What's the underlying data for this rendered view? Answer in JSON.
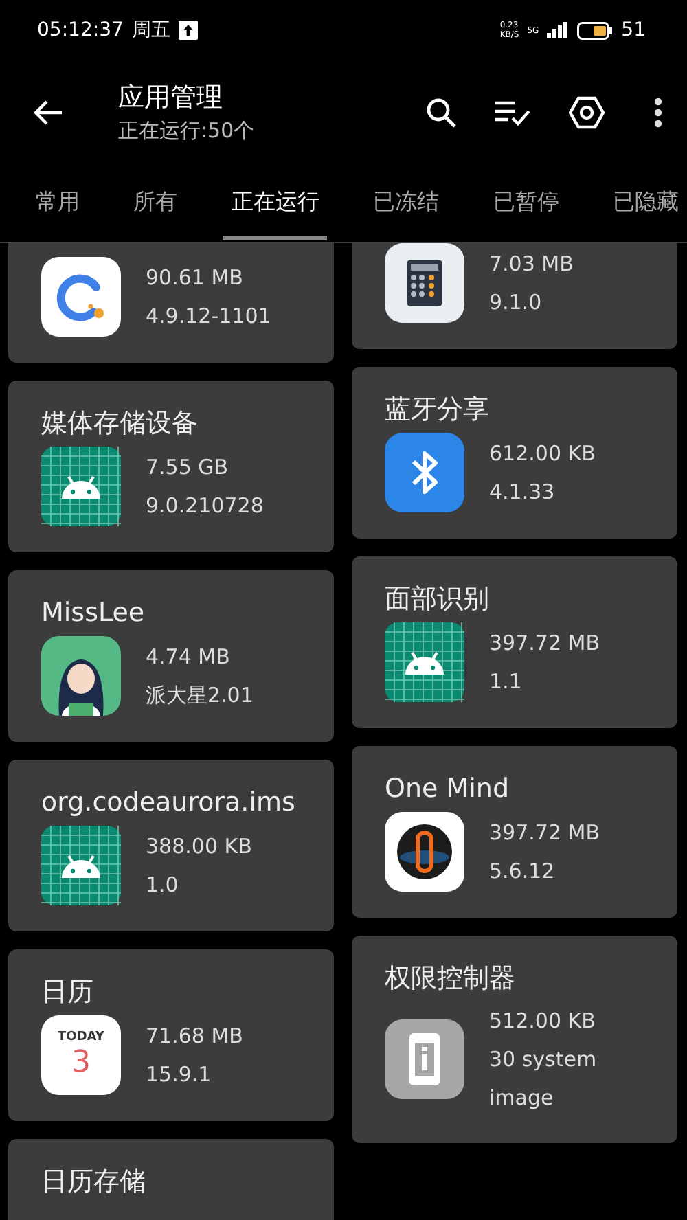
{
  "status_bar": {
    "time": "05:12:37",
    "weekday": "周五",
    "net_speed": "0.23",
    "net_unit": "KB/S",
    "network": "5G",
    "battery": "51"
  },
  "app_bar": {
    "title": "应用管理",
    "subtitle": "正在运行:50个"
  },
  "tabs": [
    {
      "label": "常用",
      "selected": false
    },
    {
      "label": "所有",
      "selected": false
    },
    {
      "label": "正在运行",
      "selected": true
    },
    {
      "label": "已冻结",
      "selected": false
    },
    {
      "label": "已暂停",
      "selected": false
    },
    {
      "label": "已隐藏",
      "selected": false
    }
  ],
  "apps_left": [
    {
      "kind": "quick",
      "size": "90.61 MB",
      "version": "4.9.12-1101"
    },
    {
      "kind": "android",
      "title": "媒体存储设备",
      "size": "7.55 GB",
      "version": "9.0.210728"
    },
    {
      "kind": "avatar",
      "title": "MissLee",
      "size": "4.74 MB",
      "version": "派大星2.01"
    },
    {
      "kind": "android",
      "title": "org.codeaurora.ims",
      "size": "388.00 KB",
      "version": "1.0"
    },
    {
      "kind": "calendar",
      "title": "日历",
      "icon_label": "TODAY",
      "icon_number": "3",
      "size": "71.68 MB",
      "version": "15.9.1"
    },
    {
      "title": "日历存储"
    }
  ],
  "apps_right": [
    {
      "kind": "calculator",
      "size": "7.03 MB",
      "version": "9.1.0"
    },
    {
      "kind": "bluetooth",
      "title": "蓝牙分享",
      "size": "612.00 KB",
      "version": "4.1.33"
    },
    {
      "kind": "android",
      "title": "面部识别",
      "size": "397.72 MB",
      "version": "1.1"
    },
    {
      "kind": "onemind",
      "title": "One Mind",
      "size": "397.72 MB",
      "version": "5.6.12"
    },
    {
      "kind": "permission",
      "title": "权限控制器",
      "size": "512.00 KB",
      "version": "30 system image"
    }
  ]
}
